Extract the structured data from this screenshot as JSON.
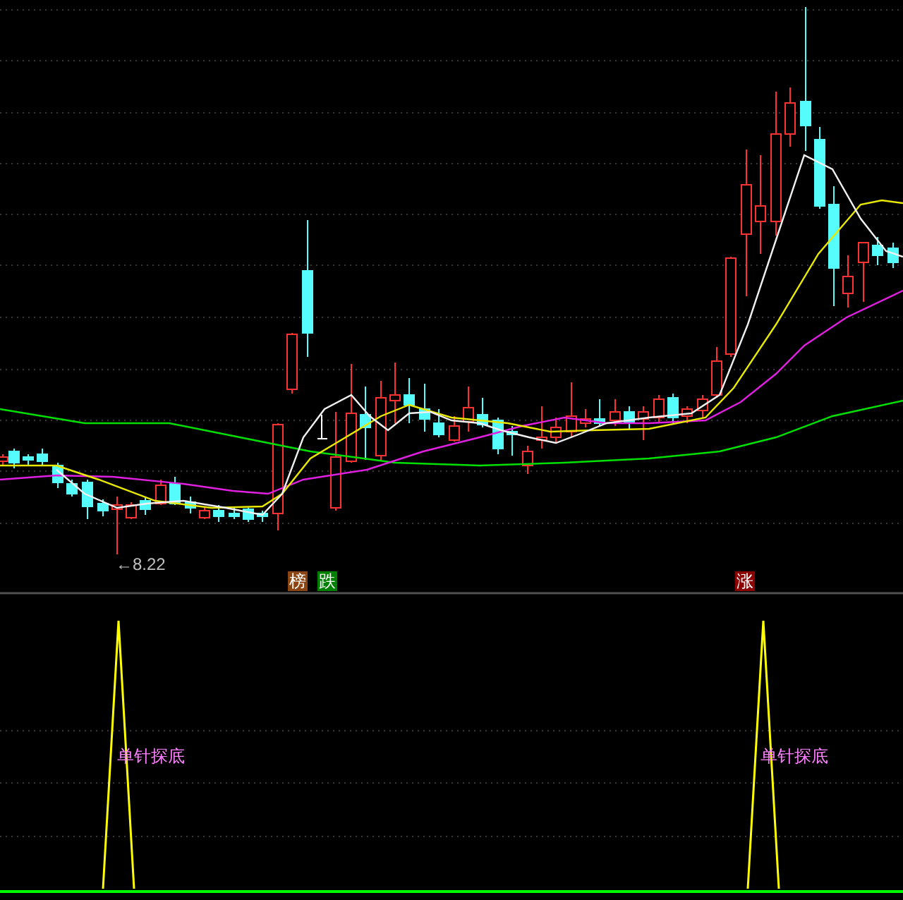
{
  "price_chart": {
    "low_marker": "←8.22",
    "badges": [
      {
        "label": "榜",
        "color": "#8b4513"
      },
      {
        "label": "跌",
        "color": "#008000"
      },
      {
        "label": "涨",
        "color": "#8b0000"
      }
    ]
  },
  "indicator": {
    "signals": [
      {
        "label": "单针探底"
      },
      {
        "label": "单针探底"
      }
    ]
  }
}
